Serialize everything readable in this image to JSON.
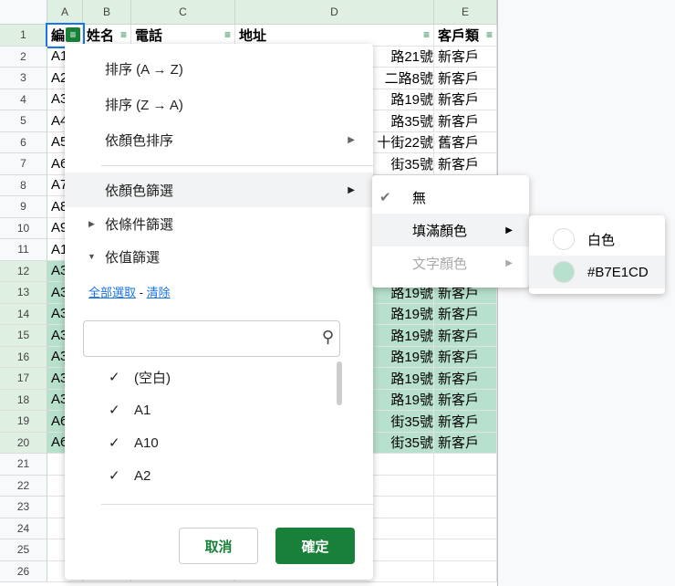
{
  "columns": [
    "A",
    "B",
    "C",
    "D",
    "E"
  ],
  "headers": [
    "編",
    "姓名",
    "電話",
    "地址",
    "客戶類"
  ],
  "rows": [
    {
      "n": "1"
    },
    {
      "n": "2",
      "a": "A1",
      "d": "路21號",
      "e": "新客戶"
    },
    {
      "n": "3",
      "a": "A2",
      "d": "二路8號",
      "e": "新客戶"
    },
    {
      "n": "4",
      "a": "A3",
      "d": "路19號",
      "e": "新客戶"
    },
    {
      "n": "5",
      "a": "A4",
      "d": "路35號",
      "e": "新客戶"
    },
    {
      "n": "6",
      "a": "A5",
      "d": "十街22號",
      "e": "舊客戶"
    },
    {
      "n": "7",
      "a": "A6",
      "d": "街35號",
      "e": "新客戶"
    },
    {
      "n": "8",
      "a": "A7",
      "d": "",
      "e": ""
    },
    {
      "n": "9",
      "a": "A8",
      "d": "",
      "e": ""
    },
    {
      "n": "10",
      "a": "A9",
      "d": "",
      "e": ""
    },
    {
      "n": "11",
      "a": "A1",
      "d": "",
      "e": ""
    },
    {
      "n": "12",
      "a": "A3",
      "d": "",
      "e": "",
      "g": true
    },
    {
      "n": "13",
      "a": "A3",
      "d": "路19號",
      "e": "新客戶",
      "g": true
    },
    {
      "n": "14",
      "a": "A3",
      "d": "路19號",
      "e": "新客戶",
      "g": true
    },
    {
      "n": "15",
      "a": "A3",
      "d": "路19號",
      "e": "新客戶",
      "g": true
    },
    {
      "n": "16",
      "a": "A3",
      "d": "路19號",
      "e": "新客戶",
      "g": true
    },
    {
      "n": "17",
      "a": "A3",
      "d": "路19號",
      "e": "新客戶",
      "g": true
    },
    {
      "n": "18",
      "a": "A3",
      "d": "路19號",
      "e": "新客戶",
      "g": true
    },
    {
      "n": "19",
      "a": "A6",
      "d": "街35號",
      "e": "新客戶",
      "g": true
    },
    {
      "n": "20",
      "a": "A6",
      "d": "街35號",
      "e": "新客戶",
      "g": true
    },
    {
      "n": "21"
    },
    {
      "n": "22"
    },
    {
      "n": "23"
    },
    {
      "n": "24"
    },
    {
      "n": "25"
    },
    {
      "n": "26"
    }
  ],
  "menu": {
    "sort_az": "排序 (A → Z)",
    "sort_za": "排序 (Z → A)",
    "sort_color": "依顏色排序",
    "filter_color": "依顏色篩選",
    "filter_condition": "依條件篩選",
    "filter_value": "依值篩選",
    "select_all": "全部選取",
    "sep": " - ",
    "clear": "清除",
    "search_placeholder": "",
    "values": [
      "(空白)",
      "A1",
      "A10",
      "A2"
    ],
    "cancel": "取消",
    "ok": "確定"
  },
  "color_sub": {
    "none": "無",
    "fill": "填滿顏色",
    "text": "文字顏色"
  },
  "fill_sub": [
    {
      "label": "白色",
      "color": "#FFFFFF"
    },
    {
      "label": "#B7E1CD",
      "color": "#B7E1CD"
    }
  ],
  "colors": {
    "accent": "#188038",
    "fill": "#b7e1cd"
  }
}
